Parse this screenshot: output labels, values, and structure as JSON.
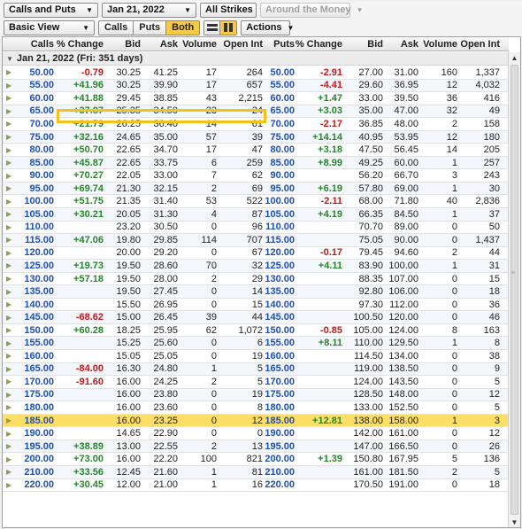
{
  "toolbar1": {
    "type_select": "Calls and Puts",
    "expiry_select": "Jan 21, 2022",
    "strikes_select": "All Strikes",
    "money_select": "Around the Money"
  },
  "toolbar2": {
    "view_select": "Basic View",
    "calls_label": "Calls",
    "puts_label": "Puts",
    "both_label": "Both",
    "actions_label": "Actions"
  },
  "headers": {
    "calls": "Calls",
    "call_pct": "% Change",
    "call_bid": "Bid",
    "call_ask": "Ask",
    "call_vol": "Volume",
    "call_oi": "Open Int",
    "puts": "Puts",
    "put_pct": "% Change",
    "put_bid": "Bid",
    "put_ask": "Ask",
    "put_vol": "Volume",
    "put_oi": "Open Int"
  },
  "expiration_group": "Jan 21, 2022 (Fri: 351 days)",
  "rows": [
    {
      "strike": "50.00",
      "cpct": "-0.79",
      "cbid": "30.25",
      "cask": "41.25",
      "cvol": "17",
      "coi": "264",
      "ppct": "-2.91",
      "pbid": "27.00",
      "pask": "31.00",
      "pvol": "160",
      "poi": "1,337"
    },
    {
      "strike": "55.00",
      "cpct": "+41.96",
      "cbid": "30.25",
      "cask": "39.90",
      "cvol": "17",
      "coi": "657",
      "ppct": "-4.41",
      "pbid": "29.60",
      "pask": "36.95",
      "pvol": "12",
      "poi": "4,032"
    },
    {
      "strike": "60.00",
      "cpct": "+41.88",
      "cbid": "29.45",
      "cask": "38.85",
      "cvol": "43",
      "coi": "2,215",
      "ppct": "+1.47",
      "pbid": "33.00",
      "pask": "39.50",
      "pvol": "36",
      "poi": "416"
    },
    {
      "strike": "65.00",
      "cpct": "+37.87",
      "cbid": "25.35",
      "cask": "34.50",
      "cvol": "23",
      "coi": "24",
      "ppct": "+3.03",
      "pbid": "35.00",
      "pask": "47.00",
      "pvol": "32",
      "poi": "49"
    },
    {
      "strike": "70.00",
      "cpct": "+21.79",
      "cbid": "26.25",
      "cask": "36.40",
      "cvol": "14",
      "coi": "61",
      "ppct": "-2.17",
      "pbid": "36.85",
      "pask": "48.00",
      "pvol": "2",
      "poi": "158"
    },
    {
      "strike": "75.00",
      "cpct": "+32.16",
      "cbid": "24.65",
      "cask": "35.00",
      "cvol": "57",
      "coi": "39",
      "ppct": "+14.14",
      "pbid": "40.95",
      "pask": "53.95",
      "pvol": "12",
      "poi": "180"
    },
    {
      "strike": "80.00",
      "cpct": "+50.70",
      "cbid": "22.65",
      "cask": "34.70",
      "cvol": "17",
      "coi": "47",
      "ppct": "+3.18",
      "pbid": "47.50",
      "pask": "56.45",
      "pvol": "14",
      "poi": "205"
    },
    {
      "strike": "85.00",
      "cpct": "+45.87",
      "cbid": "22.65",
      "cask": "33.75",
      "cvol": "6",
      "coi": "259",
      "ppct": "+8.99",
      "pbid": "49.25",
      "pask": "60.00",
      "pvol": "1",
      "poi": "257"
    },
    {
      "strike": "90.00",
      "cpct": "+70.27",
      "cbid": "22.05",
      "cask": "33.00",
      "cvol": "7",
      "coi": "62",
      "ppct": "",
      "pbid": "56.20",
      "pask": "66.70",
      "pvol": "3",
      "poi": "243"
    },
    {
      "strike": "95.00",
      "cpct": "+69.74",
      "cbid": "21.30",
      "cask": "32.15",
      "cvol": "2",
      "coi": "69",
      "ppct": "+6.19",
      "pbid": "57.80",
      "pask": "69.00",
      "pvol": "1",
      "poi": "30"
    },
    {
      "strike": "100.00",
      "cpct": "+51.75",
      "cbid": "21.35",
      "cask": "31.40",
      "cvol": "53",
      "coi": "522",
      "ppct": "-2.11",
      "pbid": "68.00",
      "pask": "71.80",
      "pvol": "40",
      "poi": "2,836"
    },
    {
      "strike": "105.00",
      "cpct": "+30.21",
      "cbid": "20.05",
      "cask": "31.30",
      "cvol": "4",
      "coi": "87",
      "ppct": "+4.19",
      "pbid": "66.35",
      "pask": "84.50",
      "pvol": "1",
      "poi": "37"
    },
    {
      "strike": "110.00",
      "cpct": "",
      "cbid": "23.20",
      "cask": "30.50",
      "cvol": "0",
      "coi": "96",
      "ppct": "",
      "pbid": "70.70",
      "pask": "89.00",
      "pvol": "0",
      "poi": "50"
    },
    {
      "strike": "115.00",
      "cpct": "+47.06",
      "cbid": "19.80",
      "cask": "29.85",
      "cvol": "114",
      "coi": "707",
      "ppct": "",
      "pbid": "75.05",
      "pask": "90.00",
      "pvol": "0",
      "poi": "1,437"
    },
    {
      "strike": "120.00",
      "cpct": "",
      "cbid": "20.00",
      "cask": "29.20",
      "cvol": "0",
      "coi": "67",
      "ppct": "-0.17",
      "pbid": "79.45",
      "pask": "94.60",
      "pvol": "2",
      "poi": "44"
    },
    {
      "strike": "125.00",
      "cpct": "+19.73",
      "cbid": "19.50",
      "cask": "28.60",
      "cvol": "70",
      "coi": "32",
      "ppct": "+4.11",
      "pbid": "83.90",
      "pask": "100.00",
      "pvol": "1",
      "poi": "31"
    },
    {
      "strike": "130.00",
      "cpct": "+57.18",
      "cbid": "19.50",
      "cask": "28.00",
      "cvol": "2",
      "coi": "29",
      "ppct": "",
      "pbid": "88.35",
      "pask": "107.00",
      "pvol": "0",
      "poi": "15"
    },
    {
      "strike": "135.00",
      "cpct": "",
      "cbid": "19.50",
      "cask": "27.45",
      "cvol": "0",
      "coi": "14",
      "ppct": "",
      "pbid": "92.80",
      "pask": "106.00",
      "pvol": "0",
      "poi": "18"
    },
    {
      "strike": "140.00",
      "cpct": "",
      "cbid": "15.50",
      "cask": "26.95",
      "cvol": "0",
      "coi": "15",
      "ppct": "",
      "pbid": "97.30",
      "pask": "112.00",
      "pvol": "0",
      "poi": "36"
    },
    {
      "strike": "145.00",
      "cpct": "-68.62",
      "cbid": "15.00",
      "cask": "26.45",
      "cvol": "39",
      "coi": "44",
      "ppct": "",
      "pbid": "100.50",
      "pask": "120.00",
      "pvol": "0",
      "poi": "46"
    },
    {
      "strike": "150.00",
      "cpct": "+60.28",
      "cbid": "18.25",
      "cask": "25.95",
      "cvol": "62",
      "coi": "1,072",
      "ppct": "-0.85",
      "pbid": "105.00",
      "pask": "124.00",
      "pvol": "8",
      "poi": "163"
    },
    {
      "strike": "155.00",
      "cpct": "",
      "cbid": "15.25",
      "cask": "25.60",
      "cvol": "0",
      "coi": "6",
      "ppct": "+8.11",
      "pbid": "110.00",
      "pask": "129.50",
      "pvol": "1",
      "poi": "8"
    },
    {
      "strike": "160.00",
      "cpct": "",
      "cbid": "15.05",
      "cask": "25.05",
      "cvol": "0",
      "coi": "19",
      "ppct": "",
      "pbid": "114.50",
      "pask": "134.00",
      "pvol": "0",
      "poi": "38"
    },
    {
      "strike": "165.00",
      "cpct": "-84.00",
      "cbid": "16.30",
      "cask": "24.80",
      "cvol": "1",
      "coi": "5",
      "ppct": "",
      "pbid": "119.00",
      "pask": "138.50",
      "pvol": "0",
      "poi": "9"
    },
    {
      "strike": "170.00",
      "cpct": "-91.60",
      "cbid": "16.00",
      "cask": "24.25",
      "cvol": "2",
      "coi": "5",
      "ppct": "",
      "pbid": "124.00",
      "pask": "143.50",
      "pvol": "0",
      "poi": "5"
    },
    {
      "strike": "175.00",
      "cpct": "",
      "cbid": "16.00",
      "cask": "23.80",
      "cvol": "0",
      "coi": "19",
      "ppct": "",
      "pbid": "128.50",
      "pask": "148.00",
      "pvol": "0",
      "poi": "12"
    },
    {
      "strike": "180.00",
      "cpct": "",
      "cbid": "16.00",
      "cask": "23.60",
      "cvol": "0",
      "coi": "8",
      "ppct": "",
      "pbid": "133.00",
      "pask": "152.50",
      "pvol": "0",
      "poi": "5"
    },
    {
      "strike": "185.00",
      "cpct": "",
      "cbid": "16.00",
      "cask": "23.25",
      "cvol": "0",
      "coi": "12",
      "ppct": "+12.81",
      "pbid": "138.00",
      "pask": "158.00",
      "pvol": "1",
      "poi": "3",
      "highlight": true
    },
    {
      "strike": "190.00",
      "cpct": "",
      "cbid": "14.65",
      "cask": "22.90",
      "cvol": "0",
      "coi": "0",
      "ppct": "",
      "pbid": "142.00",
      "pask": "161.00",
      "pvol": "0",
      "poi": "12"
    },
    {
      "strike": "195.00",
      "cpct": "+38.89",
      "cbid": "13.00",
      "cask": "22.55",
      "cvol": "2",
      "coi": "13",
      "ppct": "",
      "pbid": "147.00",
      "pask": "166.50",
      "pvol": "0",
      "poi": "26"
    },
    {
      "strike": "200.00",
      "cpct": "+73.00",
      "cbid": "16.00",
      "cask": "22.20",
      "cvol": "100",
      "coi": "821",
      "ppct": "+1.39",
      "pbid": "150.80",
      "pask": "167.95",
      "pvol": "5",
      "poi": "136"
    },
    {
      "strike": "210.00",
      "cpct": "+33.56",
      "cbid": "12.45",
      "cask": "21.60",
      "cvol": "1",
      "coi": "81",
      "ppct": "",
      "pbid": "161.00",
      "pask": "181.50",
      "pvol": "2",
      "poi": "5"
    },
    {
      "strike": "220.00",
      "cpct": "+30.45",
      "cbid": "12.00",
      "cask": "21.00",
      "cvol": "1",
      "coi": "16",
      "ppct": "",
      "pbid": "170.50",
      "pask": "191.00",
      "pvol": "0",
      "poi": "18"
    }
  ]
}
